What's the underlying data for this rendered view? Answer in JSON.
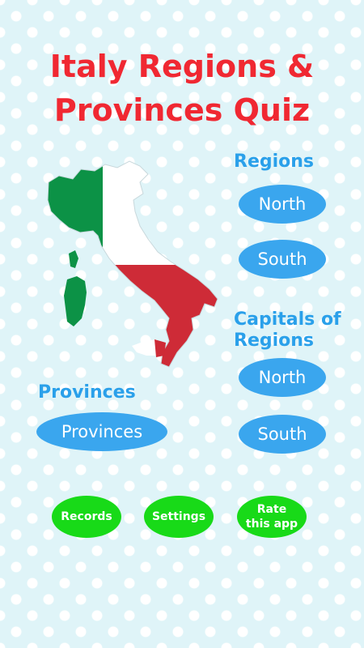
{
  "app": {
    "title_line1": "Italy Regions &",
    "title_line2": "Provinces Quiz"
  },
  "regions": {
    "label": "Regions",
    "north_button": "North",
    "south_button": "South"
  },
  "capitals": {
    "label_line1": "Capitals of",
    "label_line2": "Regions",
    "north_button": "North",
    "south_button": "South"
  },
  "provinces": {
    "label": "Provinces",
    "button": "Provinces"
  },
  "footer": {
    "records_button": "Records",
    "settings_button": "Settings",
    "rate_line1": "Rate",
    "rate_line2": "this app"
  },
  "colors": {
    "title_red": "#f02832",
    "accent_blue": "#3aa6ee",
    "label_blue": "#2aa0ea",
    "footer_green": "#18da18",
    "flag_green": "#0c9246",
    "flag_white": "#ffffff",
    "flag_red": "#ce2b37"
  },
  "map": {
    "icon": "italy-flag-map-icon"
  }
}
